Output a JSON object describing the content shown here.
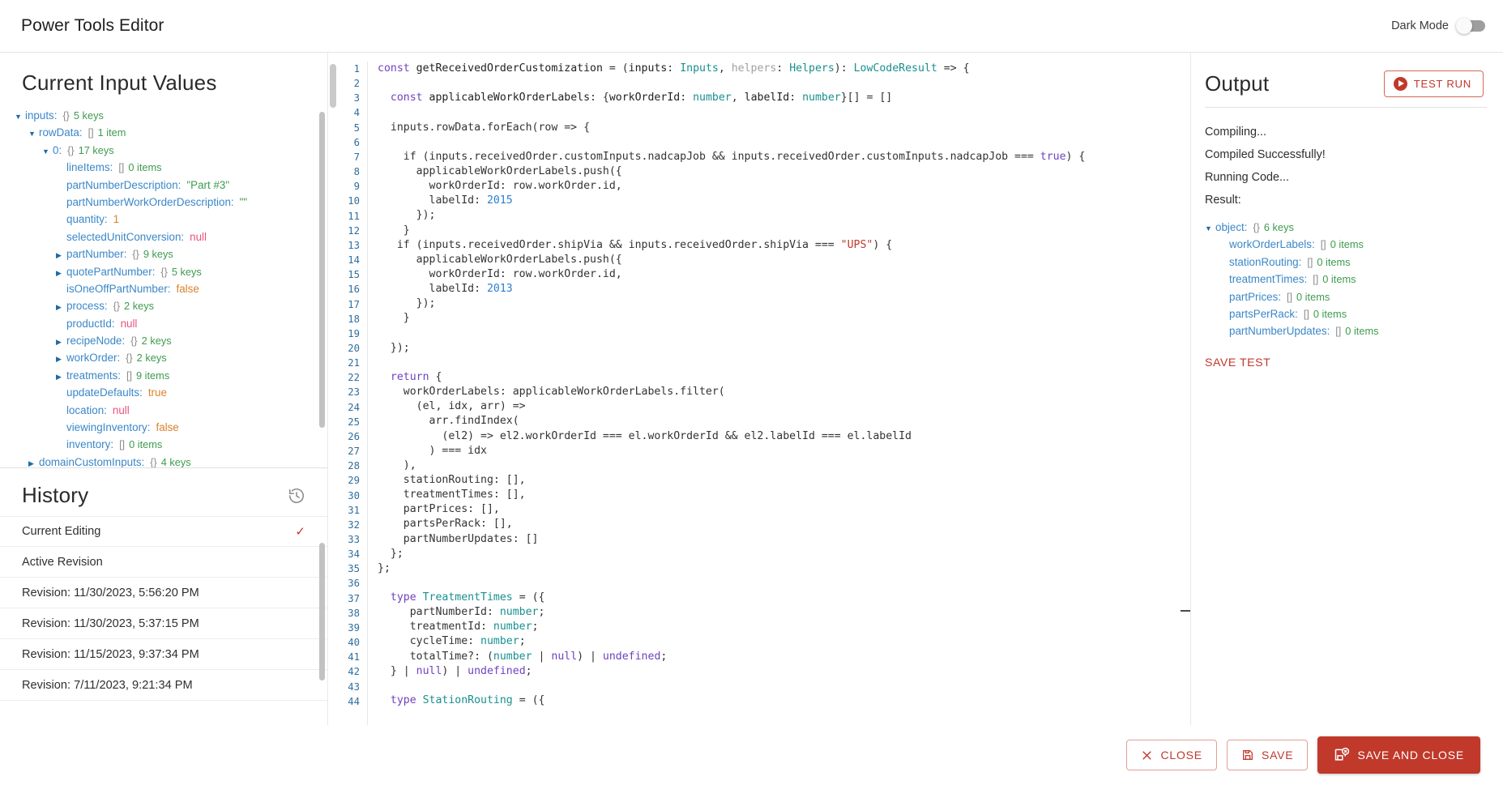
{
  "topbar": {
    "title": "Power Tools Editor",
    "dark_mode_label": "Dark Mode",
    "dark_mode_on": false
  },
  "inputs_panel": {
    "heading": "Current Input Values",
    "tree": [
      {
        "indent": 0,
        "caret": "open",
        "key": "inputs:",
        "meta": "{}",
        "count": "5 keys"
      },
      {
        "indent": 1,
        "caret": "open",
        "key": "rowData:",
        "meta": "[]",
        "count": "1 item"
      },
      {
        "indent": 2,
        "caret": "open",
        "key": "0:",
        "meta": "{}",
        "count": "17 keys"
      },
      {
        "indent": 3,
        "caret": "none",
        "key": "lineItems:",
        "meta": "[]",
        "count": "0 items"
      },
      {
        "indent": 3,
        "caret": "none",
        "key": "partNumberDescription:",
        "value": "\"Part #3\"",
        "vtype": "string"
      },
      {
        "indent": 3,
        "caret": "none",
        "key": "partNumberWorkOrderDescription:",
        "value": "\"\"",
        "vtype": "string"
      },
      {
        "indent": 3,
        "caret": "none",
        "key": "quantity:",
        "value": "1",
        "vtype": "number"
      },
      {
        "indent": 3,
        "caret": "none",
        "key": "selectedUnitConversion:",
        "value": "null",
        "vtype": "null"
      },
      {
        "indent": 3,
        "caret": "closed",
        "key": "partNumber:",
        "meta": "{}",
        "count": "9 keys"
      },
      {
        "indent": 3,
        "caret": "closed",
        "key": "quotePartNumber:",
        "meta": "{}",
        "count": "5 keys"
      },
      {
        "indent": 3,
        "caret": "none",
        "key": "isOneOffPartNumber:",
        "value": "false",
        "vtype": "bool"
      },
      {
        "indent": 3,
        "caret": "closed",
        "key": "process:",
        "meta": "{}",
        "count": "2 keys"
      },
      {
        "indent": 3,
        "caret": "none",
        "key": "productId:",
        "value": "null",
        "vtype": "null"
      },
      {
        "indent": 3,
        "caret": "closed",
        "key": "recipeNode:",
        "meta": "{}",
        "count": "2 keys"
      },
      {
        "indent": 3,
        "caret": "closed",
        "key": "workOrder:",
        "meta": "{}",
        "count": "2 keys"
      },
      {
        "indent": 3,
        "caret": "closed",
        "key": "treatments:",
        "meta": "[]",
        "count": "9 items"
      },
      {
        "indent": 3,
        "caret": "none",
        "key": "updateDefaults:",
        "value": "true",
        "vtype": "bool"
      },
      {
        "indent": 3,
        "caret": "none",
        "key": "location:",
        "value": "null",
        "vtype": "null"
      },
      {
        "indent": 3,
        "caret": "none",
        "key": "viewingInventory:",
        "value": "false",
        "vtype": "bool"
      },
      {
        "indent": 3,
        "caret": "none",
        "key": "inventory:",
        "meta": "[]",
        "count": "0 items"
      },
      {
        "indent": 1,
        "caret": "closed",
        "key": "domainCustomInputs:",
        "meta": "{}",
        "count": "4 keys"
      }
    ]
  },
  "history_panel": {
    "heading": "History",
    "icon": "history-restore-icon",
    "items": [
      {
        "label": "Current Editing",
        "selected": true
      },
      {
        "label": "Active Revision",
        "selected": false
      },
      {
        "label": "Revision: 11/30/2023, 5:56:20 PM",
        "selected": false
      },
      {
        "label": "Revision: 11/30/2023, 5:37:15 PM",
        "selected": false
      },
      {
        "label": "Revision: 11/15/2023, 9:37:34 PM",
        "selected": false
      },
      {
        "label": "Revision: 7/11/2023, 9:21:34 PM",
        "selected": false
      }
    ]
  },
  "editor": {
    "first_line_number": 1,
    "lines": [
      {
        "n": 1,
        "t": [
          [
            "kw",
            "const "
          ],
          [
            "fn",
            "getReceivedOrderCustomization"
          ],
          [
            "pun",
            " = ("
          ],
          [
            "fn",
            "inputs"
          ],
          [
            "pun",
            ": "
          ],
          [
            "typ",
            "Inputs"
          ],
          [
            "pun",
            ", "
          ],
          [
            "dim",
            "helpers"
          ],
          [
            "pun",
            ": "
          ],
          [
            "typ",
            "Helpers"
          ],
          [
            "pun",
            "): "
          ],
          [
            "typ",
            "LowCodeResult"
          ],
          [
            "pun",
            " => {"
          ]
        ]
      },
      {
        "n": 2,
        "t": []
      },
      {
        "n": 3,
        "t": [
          [
            "pun",
            "  "
          ],
          [
            "kw",
            "const "
          ],
          [
            "fn",
            "applicableWorkOrderLabels"
          ],
          [
            "pun",
            ": {"
          ],
          [
            "fn",
            "workOrderId"
          ],
          [
            "pun",
            ": "
          ],
          [
            "typ",
            "number"
          ],
          [
            "pun",
            ", "
          ],
          [
            "fn",
            "labelId"
          ],
          [
            "pun",
            ": "
          ],
          [
            "typ",
            "number"
          ],
          [
            "pun",
            "}[] = []"
          ]
        ]
      },
      {
        "n": 4,
        "t": []
      },
      {
        "n": 5,
        "t": [
          [
            "pun",
            "  inputs.rowData.forEach(row => {"
          ]
        ]
      },
      {
        "n": 6,
        "t": []
      },
      {
        "n": 7,
        "t": [
          [
            "pun",
            "    if (inputs.receivedOrder.customInputs.nadcapJob && inputs.receivedOrder.customInputs.nadcapJob === "
          ],
          [
            "bool",
            "true"
          ],
          [
            "pun",
            ") {"
          ]
        ]
      },
      {
        "n": 8,
        "t": [
          [
            "pun",
            "      applicableWorkOrderLabels.push({"
          ]
        ]
      },
      {
        "n": 9,
        "t": [
          [
            "pun",
            "        workOrderId: row.workOrder.id,"
          ]
        ]
      },
      {
        "n": 10,
        "t": [
          [
            "pun",
            "        labelId: "
          ],
          [
            "num",
            "2015"
          ]
        ]
      },
      {
        "n": 11,
        "t": [
          [
            "pun",
            "      });"
          ]
        ]
      },
      {
        "n": 12,
        "t": [
          [
            "pun",
            "    }"
          ]
        ]
      },
      {
        "n": 13,
        "t": [
          [
            "pun",
            "   if (inputs.receivedOrder.shipVia && inputs.receivedOrder.shipVia === "
          ],
          [
            "str",
            "\"UPS\""
          ],
          [
            "pun",
            ") {"
          ]
        ]
      },
      {
        "n": 14,
        "t": [
          [
            "pun",
            "      applicableWorkOrderLabels.push({"
          ]
        ]
      },
      {
        "n": 15,
        "t": [
          [
            "pun",
            "        workOrderId: row.workOrder.id,"
          ]
        ]
      },
      {
        "n": 16,
        "t": [
          [
            "pun",
            "        labelId: "
          ],
          [
            "num",
            "2013"
          ]
        ]
      },
      {
        "n": 17,
        "t": [
          [
            "pun",
            "      });"
          ]
        ]
      },
      {
        "n": 18,
        "t": [
          [
            "pun",
            "    }"
          ]
        ]
      },
      {
        "n": 19,
        "t": []
      },
      {
        "n": 20,
        "t": [
          [
            "pun",
            "  });"
          ]
        ]
      },
      {
        "n": 21,
        "t": []
      },
      {
        "n": 22,
        "t": [
          [
            "pun",
            "  "
          ],
          [
            "kw",
            "return"
          ],
          [
            "pun",
            " {"
          ]
        ]
      },
      {
        "n": 23,
        "t": [
          [
            "pun",
            "    workOrderLabels: applicableWorkOrderLabels.filter("
          ]
        ]
      },
      {
        "n": 24,
        "t": [
          [
            "pun",
            "      (el, idx, arr) =>"
          ]
        ]
      },
      {
        "n": 25,
        "t": [
          [
            "pun",
            "        arr.findIndex("
          ]
        ]
      },
      {
        "n": 26,
        "t": [
          [
            "pun",
            "          (el2) => el2.workOrderId === el.workOrderId && el2.labelId === el.labelId"
          ]
        ]
      },
      {
        "n": 27,
        "t": [
          [
            "pun",
            "        ) === idx"
          ]
        ]
      },
      {
        "n": 28,
        "t": [
          [
            "pun",
            "    ),"
          ]
        ]
      },
      {
        "n": 29,
        "t": [
          [
            "pun",
            "    stationRouting: [],"
          ]
        ]
      },
      {
        "n": 30,
        "t": [
          [
            "pun",
            "    treatmentTimes: [],"
          ]
        ]
      },
      {
        "n": 31,
        "t": [
          [
            "pun",
            "    partPrices: [],"
          ]
        ]
      },
      {
        "n": 32,
        "t": [
          [
            "pun",
            "    partsPerRack: [],"
          ]
        ]
      },
      {
        "n": 33,
        "t": [
          [
            "pun",
            "    partNumberUpdates: []"
          ]
        ]
      },
      {
        "n": 34,
        "t": [
          [
            "pun",
            "  };"
          ]
        ]
      },
      {
        "n": 35,
        "t": [
          [
            "pun",
            "};"
          ]
        ]
      },
      {
        "n": 36,
        "t": []
      },
      {
        "n": 37,
        "t": [
          [
            "pun",
            "  "
          ],
          [
            "kw",
            "type "
          ],
          [
            "typ",
            "TreatmentTimes"
          ],
          [
            "pun",
            " = ({"
          ]
        ]
      },
      {
        "n": 38,
        "t": [
          [
            "pun",
            "     partNumberId: "
          ],
          [
            "typ",
            "number"
          ],
          [
            "pun",
            ";"
          ]
        ]
      },
      {
        "n": 39,
        "t": [
          [
            "pun",
            "     treatmentId: "
          ],
          [
            "typ",
            "number"
          ],
          [
            "pun",
            ";"
          ]
        ]
      },
      {
        "n": 40,
        "t": [
          [
            "pun",
            "     cycleTime: "
          ],
          [
            "typ",
            "number"
          ],
          [
            "pun",
            ";"
          ]
        ]
      },
      {
        "n": 41,
        "t": [
          [
            "pun",
            "     totalTime?: ("
          ],
          [
            "typ",
            "number"
          ],
          [
            "pun",
            " | "
          ],
          [
            "kw",
            "null"
          ],
          [
            "pun",
            ") | "
          ],
          [
            "kw",
            "undefined"
          ],
          [
            "pun",
            ";"
          ]
        ]
      },
      {
        "n": 42,
        "t": [
          [
            "pun",
            "  } | "
          ],
          [
            "kw",
            "null"
          ],
          [
            "pun",
            ") | "
          ],
          [
            "kw",
            "undefined"
          ],
          [
            "pun",
            ";"
          ]
        ]
      },
      {
        "n": 43,
        "t": []
      },
      {
        "n": 44,
        "t": [
          [
            "pun",
            "  "
          ],
          [
            "kw",
            "type "
          ],
          [
            "typ",
            "StationRouting"
          ],
          [
            "pun",
            " = ({"
          ]
        ]
      }
    ]
  },
  "output_panel": {
    "heading": "Output",
    "test_run_label": "TEST RUN",
    "logs": [
      "Compiling...",
      "Compiled Successfully!",
      "Running Code...",
      "Result:"
    ],
    "result_tree": [
      {
        "indent": 0,
        "caret": "open",
        "key": "object:",
        "meta": "{}",
        "count": "6 keys"
      },
      {
        "indent": 1,
        "caret": "none",
        "key": "workOrderLabels:",
        "meta": "[]",
        "count": "0 items"
      },
      {
        "indent": 1,
        "caret": "none",
        "key": "stationRouting:",
        "meta": "[]",
        "count": "0 items"
      },
      {
        "indent": 1,
        "caret": "none",
        "key": "treatmentTimes:",
        "meta": "[]",
        "count": "0 items"
      },
      {
        "indent": 1,
        "caret": "none",
        "key": "partPrices:",
        "meta": "[]",
        "count": "0 items"
      },
      {
        "indent": 1,
        "caret": "none",
        "key": "partsPerRack:",
        "meta": "[]",
        "count": "0 items"
      },
      {
        "indent": 1,
        "caret": "none",
        "key": "partNumberUpdates:",
        "meta": "[]",
        "count": "0 items"
      }
    ],
    "save_test_label": "SAVE TEST"
  },
  "footer": {
    "close_label": "CLOSE",
    "save_label": "SAVE",
    "save_and_close_label": "SAVE AND CLOSE"
  },
  "colors": {
    "accent": "#c0392b",
    "key": "#3a87c8",
    "count": "#3e9b4f",
    "number": "#d9822b",
    "null": "#e8547f"
  }
}
